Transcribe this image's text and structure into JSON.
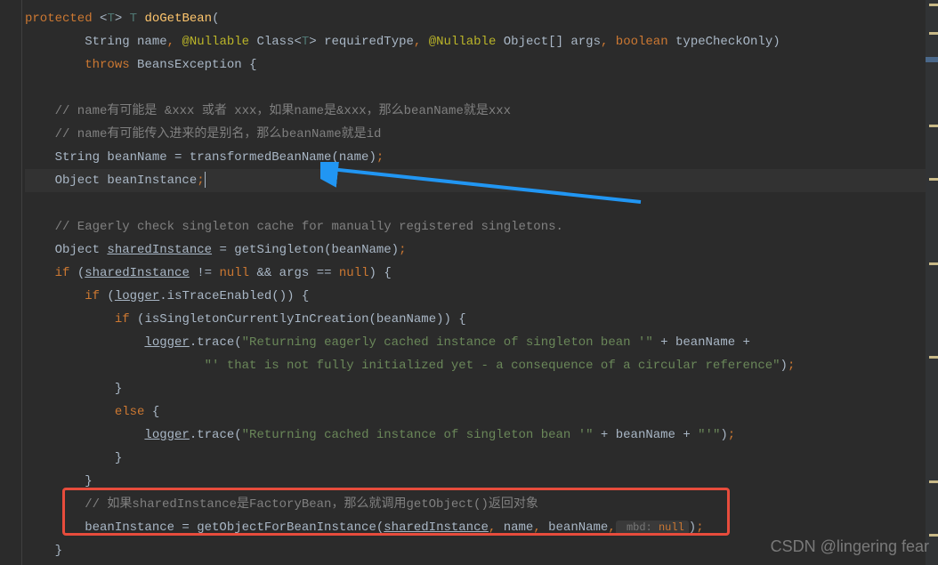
{
  "code": {
    "l1_protected": "protected",
    "l1_lt": " <",
    "l1_T1": "T",
    "l1_gt": "> ",
    "l1_T2": "T",
    "l1_method": " doGetBean",
    "l1_paren": "(",
    "l2_pre": "        String name",
    "l2_comma1": ", ",
    "l2_ann1": "@Nullable",
    "l2_class": " Class<",
    "l2_T": "T",
    "l2_gt": "> requiredType",
    "l2_comma2": ", ",
    "l2_ann2": "@Nullable",
    "l2_obj": " Object[] args",
    "l2_comma3": ", ",
    "l2_bool": "boolean",
    "l2_tco": " typeCheckOnly)",
    "l3_indent": "        ",
    "l3_throws": "throws",
    "l3_rest": " BeansException {",
    "l5": "    // name有可能是 &xxx 或者 xxx，如果name是&xxx，那么beanName就是xxx",
    "l6": "    // name有可能传入进来的是别名，那么beanName就是id",
    "l7_pre": "    String beanName = transformedBeanName(name)",
    "l7_semi": ";",
    "l8_pre": "    Object beanInstance",
    "l8_semi": ";",
    "l10": "    // Eagerly check singleton cache for manually registered singletons.",
    "l11_pre": "    Object ",
    "l11_shared": "sharedInstance",
    "l11_mid": " = getSingleton(beanName)",
    "l11_semi": ";",
    "l12_indent": "    ",
    "l12_if": "if",
    "l12_paren": " (",
    "l12_shared": "sharedInstance",
    "l12_ne": " != ",
    "l12_null1": "null",
    "l12_and": " && args == ",
    "l12_null2": "null",
    "l12_end": ") {",
    "l13_indent": "        ",
    "l13_if": "if",
    "l13_paren": " (",
    "l13_logger": "logger",
    "l13_rest": ".isTraceEnabled()) {",
    "l14_indent": "            ",
    "l14_if": "if",
    "l14_rest": " (isSingletonCurrentlyInCreation(beanName)) {",
    "l15_indent": "                ",
    "l15_logger": "logger",
    "l15_trace": ".trace(",
    "l15_str": "\"Returning eagerly cached instance of singleton bean '\"",
    "l15_plus": " + beanName +",
    "l16_indent": "                        ",
    "l16_str": "\"' that is not fully initialized yet - a consequence of a circular reference\"",
    "l16_end": ")",
    "l16_semi": ";",
    "l17": "            }",
    "l18_indent": "            ",
    "l18_else": "else",
    "l18_brace": " {",
    "l19_indent": "                ",
    "l19_logger": "logger",
    "l19_trace": ".trace(",
    "l19_str": "\"Returning cached instance of singleton bean '\"",
    "l19_plus": " + beanName + ",
    "l19_str2": "\"'\"",
    "l19_end": ")",
    "l19_semi": ";",
    "l20": "            }",
    "l21": "        }",
    "l22": "        // 如果sharedInstance是FactoryBean，那么就调用getObject()返回对象",
    "l23_pre": "        beanInstance = getObjectForBeanInstance(",
    "l23_shared": "sharedInstance",
    "l23_c1": ",",
    "l23_name": " name",
    "l23_c2": ",",
    "l23_bean": " beanName",
    "l23_c3": ",",
    "l23_hint": " mbd: ",
    "l23_null": "null",
    "l23_end": ")",
    "l23_semi": ";",
    "l24": "    }"
  },
  "watermark": "CSDN @lingering fear"
}
